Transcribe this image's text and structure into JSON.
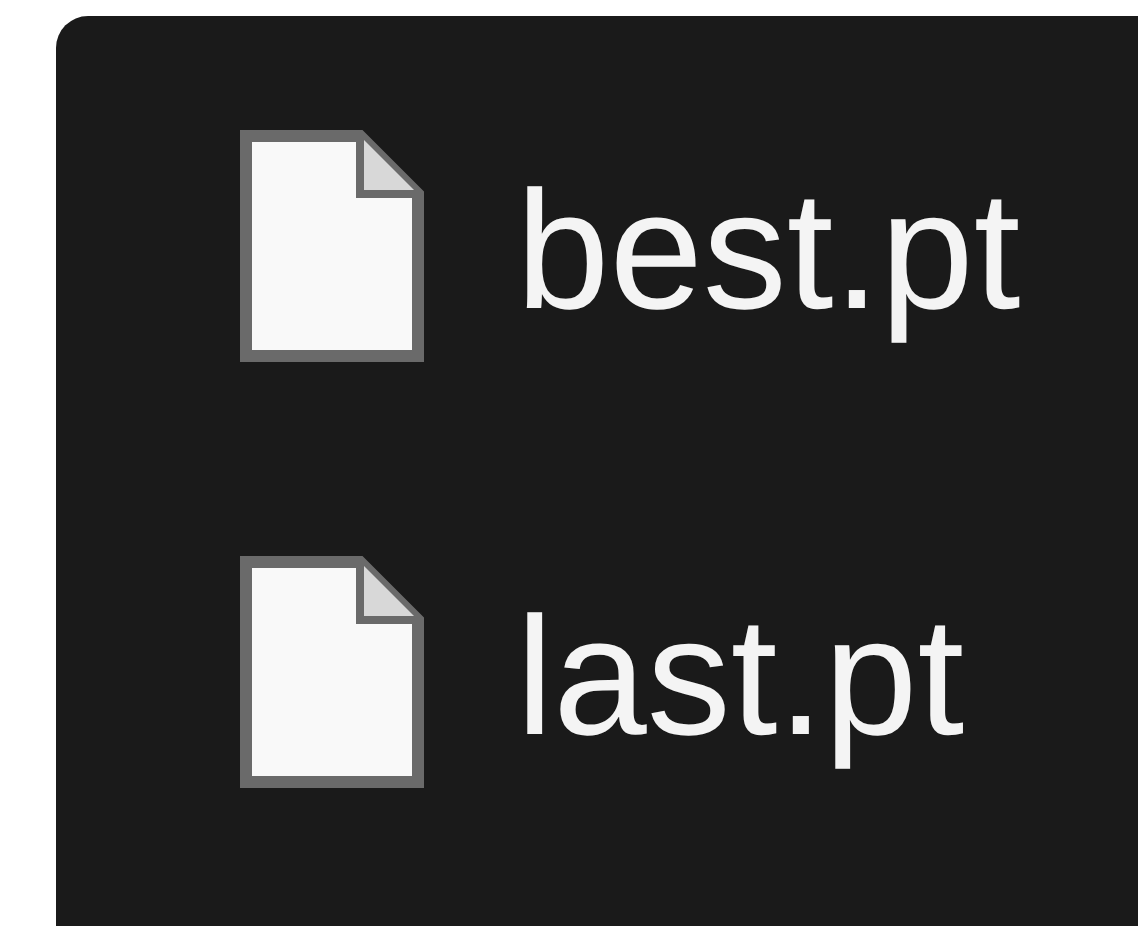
{
  "files": [
    {
      "name": "best.pt"
    },
    {
      "name": "last.pt"
    }
  ]
}
